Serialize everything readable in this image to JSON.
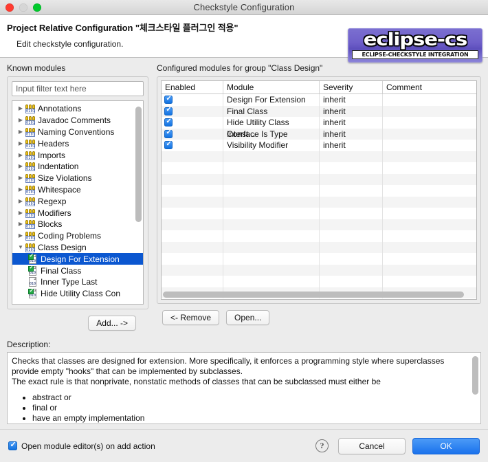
{
  "window": {
    "title": "Checkstyle Configuration",
    "traffic_lights": [
      "close",
      "minimize",
      "zoom"
    ]
  },
  "header": {
    "title": "Project Relative Configuration \"체크스타일 플러그인 적용\"",
    "subtitle": "Edit checkstyle configuration.",
    "logo_main": "eclipse-cs",
    "logo_sub": "ECLIPSE-CHECKSTYLE INTEGRATION",
    "logo_bg": "#6e5fc9"
  },
  "left_panel": {
    "label": "Known modules",
    "filter_placeholder": "Input filter text here",
    "filter_value": "",
    "tree": [
      {
        "label": "Annotations",
        "expanded": false,
        "type": "group"
      },
      {
        "label": "Javadoc Comments",
        "expanded": false,
        "type": "group"
      },
      {
        "label": "Naming Conventions",
        "expanded": false,
        "type": "group"
      },
      {
        "label": "Headers",
        "expanded": false,
        "type": "group"
      },
      {
        "label": "Imports",
        "expanded": false,
        "type": "group"
      },
      {
        "label": "Indentation",
        "expanded": false,
        "type": "group"
      },
      {
        "label": "Size Violations",
        "expanded": false,
        "type": "group"
      },
      {
        "label": "Whitespace",
        "expanded": false,
        "type": "group"
      },
      {
        "label": "Regexp",
        "expanded": false,
        "type": "group"
      },
      {
        "label": "Modifiers",
        "expanded": false,
        "type": "group"
      },
      {
        "label": "Blocks",
        "expanded": false,
        "type": "group"
      },
      {
        "label": "Coding Problems",
        "expanded": false,
        "type": "group"
      },
      {
        "label": "Class Design",
        "expanded": true,
        "type": "group"
      },
      {
        "label": "Design For Extension",
        "type": "leaf",
        "checked": true,
        "selected": true
      },
      {
        "label": "Final Class",
        "type": "leaf",
        "checked": true,
        "selected": false
      },
      {
        "label": "Inner Type Last",
        "type": "leaf",
        "checked": false,
        "selected": false
      },
      {
        "label": "Hide Utility Class Con",
        "type": "leaf",
        "checked": true,
        "selected": false
      }
    ],
    "add_button": "Add... ->"
  },
  "right_panel": {
    "label": "Configured modules for group \"Class Design\"",
    "columns": [
      "Enabled",
      "Module",
      "Severity",
      "Comment"
    ],
    "rows": [
      {
        "enabled": true,
        "module": "Design For Extension",
        "severity": "inherit",
        "comment": ""
      },
      {
        "enabled": true,
        "module": "Final Class",
        "severity": "inherit",
        "comment": ""
      },
      {
        "enabled": true,
        "module": "Hide Utility Class Const...",
        "severity": "inherit",
        "comment": ""
      },
      {
        "enabled": true,
        "module": "Interface Is Type",
        "severity": "inherit",
        "comment": ""
      },
      {
        "enabled": true,
        "module": "Visibility Modifier",
        "severity": "inherit",
        "comment": ""
      }
    ],
    "remove_button": "<- Remove",
    "open_button": "Open..."
  },
  "description": {
    "label": "Description:",
    "paragraph1": "Checks that classes are designed for extension. More specifically, it enforces a programming style where superclasses provide empty \"hooks\" that can be implemented by subclasses.",
    "paragraph2": "The exact rule is that nonprivate, nonstatic methods of classes that can be subclassed must either be",
    "bullets": [
      "abstract or",
      "final or",
      "have an empty implementation"
    ]
  },
  "footer": {
    "checkbox_label": "Open module editor(s) on add action",
    "checkbox_checked": true,
    "help_glyph": "?",
    "cancel_label": "Cancel",
    "ok_label": "OK",
    "ok_color": "#1a72ec"
  }
}
